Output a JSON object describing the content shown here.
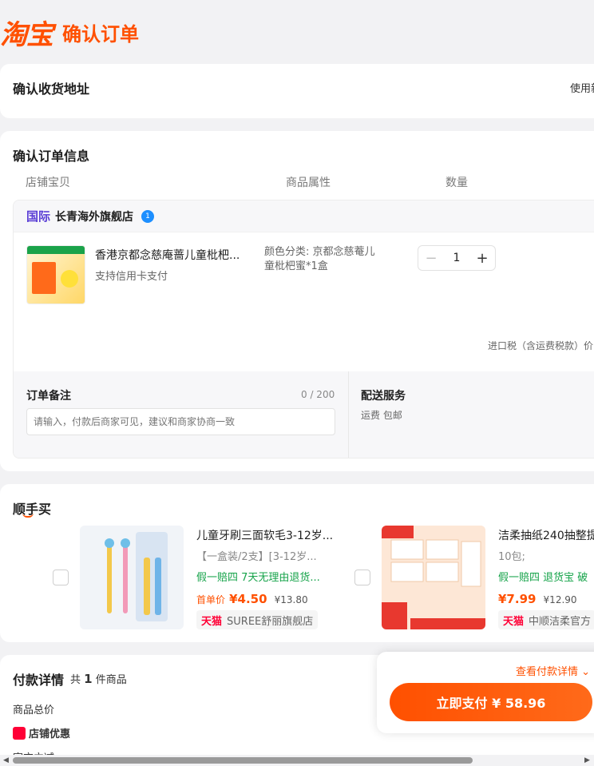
{
  "header": {
    "logo": "淘宝",
    "title": "确认订单"
  },
  "address": {
    "title": "确认收货地址",
    "use_text": "使用新"
  },
  "order": {
    "title": "确认订单信息",
    "columns": [
      "店铺宝贝",
      "商品属性",
      "数量"
    ],
    "shop": {
      "region": "国际",
      "name": "长青海外旗舰店",
      "badge": "1"
    },
    "product": {
      "name": "香港京都念慈庵蔷儿童枇杷...",
      "sub": "支持信用卡支付",
      "attr": "颜色分类: 京都念慈菴儿童枇杷蜜*1盒",
      "qty": "1",
      "minus": "−",
      "plus": "+"
    },
    "tax": "进口税（含运费税款）价",
    "remark": {
      "label": "订单备注",
      "count": "0 / 200",
      "placeholder": "请输入，付款后商家可见，建议和商家协商一致"
    },
    "shipping": {
      "label": "配送服务",
      "value": "运费 包邮"
    }
  },
  "recommend": {
    "title": "顺手买",
    "items": [
      {
        "name": "儿童牙刷三面软毛3-12岁...",
        "spec": "【一盒装/2支】[3-12岁...",
        "tags": "假一赔四  7天无理由退货...",
        "price_label": "首单价",
        "price": "¥4.50",
        "old_price": "¥13.80",
        "mall": "天猫",
        "shop": "SUREE舒丽旗舰店"
      },
      {
        "name": "洁柔抽纸240抽整提",
        "spec": "10包;",
        "tags": "假一赔四  退货宝  破",
        "price_label": "",
        "price": "¥7.99",
        "old_price": "¥12.90",
        "mall": "天猫",
        "shop": "中顺洁柔官方"
      }
    ]
  },
  "payment": {
    "title": "付款详情",
    "count_prefix": "共",
    "count": "1",
    "count_suffix": "件商品",
    "rows": [
      "商品总价",
      "店铺优惠",
      "官方立减"
    ],
    "detail_link": "查看付款详情 ⌄",
    "pay_button": "立即支付 ¥ 58.96"
  },
  "colors": {
    "accent": "#ff5000",
    "tmall": "#ff0036",
    "green": "#16a34a"
  }
}
